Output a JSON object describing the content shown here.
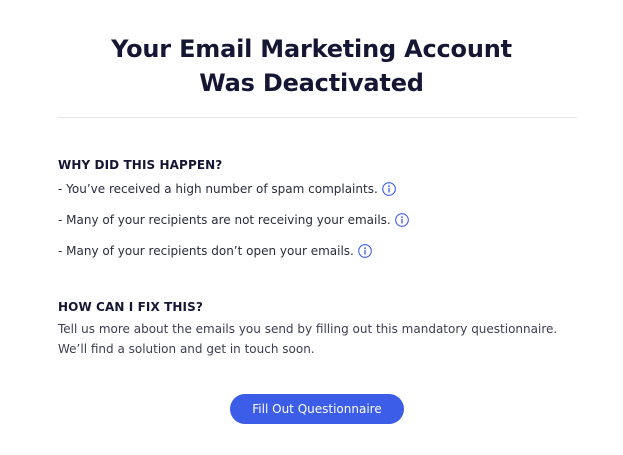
{
  "title": {
    "line1": "Your Email Marketing Account",
    "line2": "Was Deactivated"
  },
  "why": {
    "heading": "WHY DID THIS HAPPEN?",
    "reasons": [
      "- You’ve received a high number of spam complaints.",
      "- Many of your recipients are not receiving your emails.",
      "- Many of your recipients don’t open your emails."
    ],
    "info_icon": "info-circle-icon"
  },
  "fix": {
    "heading": "HOW CAN I FIX THIS?",
    "line1": "Tell us more about the emails you send by filling out this mandatory questionnaire.",
    "line2": "We’ll find a solution and get in touch soon."
  },
  "cta": {
    "label": "Fill Out Questionnaire"
  },
  "colors": {
    "accent": "#3b5de7",
    "heading": "#151633",
    "divider": "#e3e5ea"
  }
}
